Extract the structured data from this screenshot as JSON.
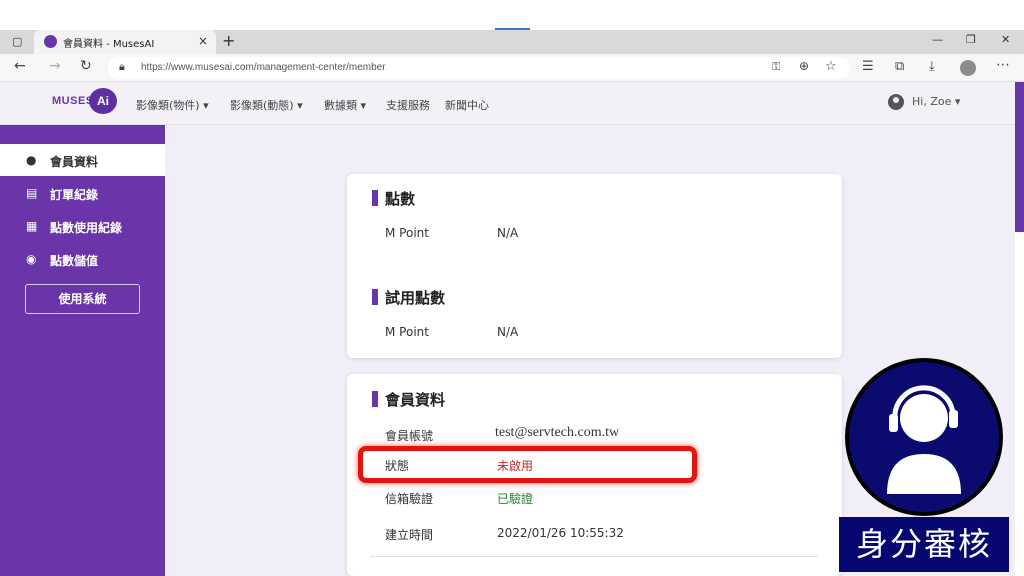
{
  "browser": {
    "tab_title": "會員資料 - MusesAI",
    "url": "https://www.musesai.com/management-center/member",
    "new_tab": "+",
    "close_tab": "×",
    "minimize": "—",
    "restore": "❐",
    "close": "✕"
  },
  "site": {
    "logo_text": "MUSES",
    "logo_badge": "Ai",
    "nav": [
      "影像類(物件)",
      "影像類(動態)",
      "數據類",
      "支援服務",
      "新聞中心"
    ],
    "user": "Hi, Zoe"
  },
  "sidebar": {
    "items": [
      {
        "label": "會員資料",
        "icon": "account-circle-icon",
        "active": true
      },
      {
        "label": "訂單紀錄",
        "icon": "document-icon",
        "active": false
      },
      {
        "label": "點數使用紀錄",
        "icon": "history-icon",
        "active": false
      },
      {
        "label": "點數儲值",
        "icon": "coin-icon",
        "active": false
      }
    ],
    "button": "使用系統"
  },
  "points": {
    "title": "點數",
    "label": "M Point",
    "value": "N/A"
  },
  "trial": {
    "title": "試用點數",
    "label": "M Point",
    "value": "N/A"
  },
  "member": {
    "title": "會員資料",
    "rows": [
      {
        "label": "會員帳號",
        "value": "test@servtech.com.tw"
      },
      {
        "label": "狀態",
        "value": "未啟用"
      },
      {
        "label": "信箱驗證",
        "value": "已驗證"
      },
      {
        "label": "建立時間",
        "value": "2022/01/26 10:55:32"
      }
    ]
  },
  "overlay": {
    "verify_label": "身分審核"
  },
  "colors": {
    "brand": "#6a35a8",
    "status_inactive": "#c1272d",
    "status_verified": "#2f7d32",
    "highlight": "#e3140f"
  }
}
